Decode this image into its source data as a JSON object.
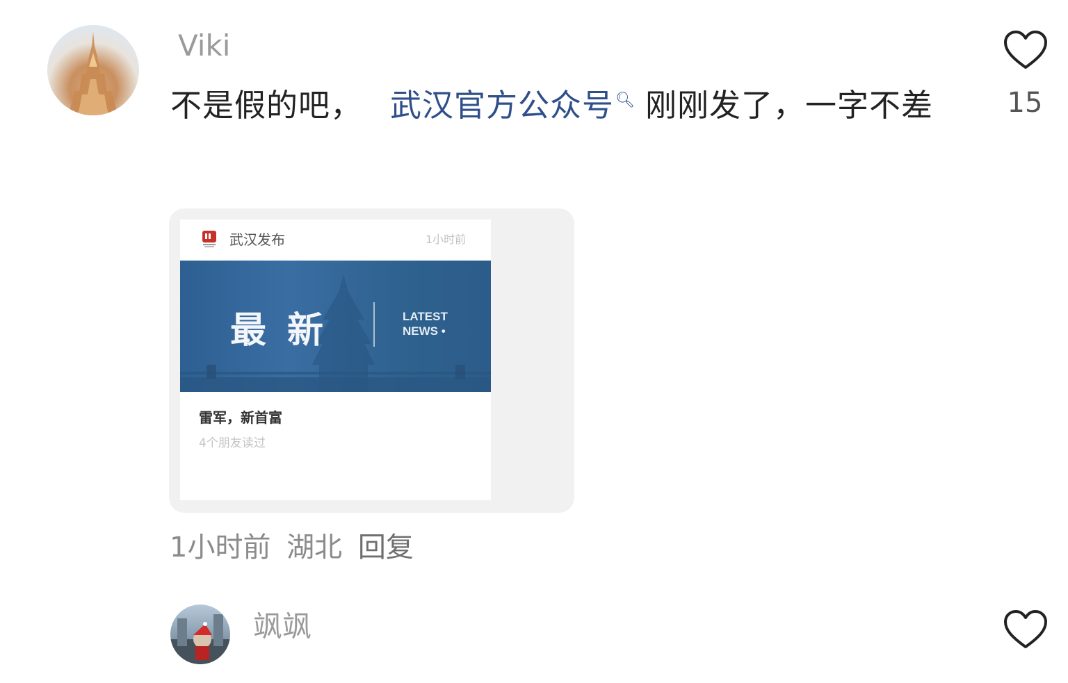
{
  "comment1": {
    "username": "Viki",
    "text_before": "不是假的吧，",
    "link_text": "武汉官方公众号",
    "link_icon": "search-icon",
    "text_after": "刚刚发了，一字不差",
    "like_icon": "heart-outline-icon",
    "like_count": "15",
    "card": {
      "source": "武汉发布",
      "time": "1小时前",
      "banner_cn": "最新",
      "banner_en_1": "LATEST",
      "banner_en_2": "NEWS •",
      "headline": "雷军，新首富",
      "readers": "4个朋友读过"
    },
    "meta_time": "1小时前",
    "meta_location": "湖北",
    "meta_reply": "回复"
  },
  "comment2": {
    "username": "飒飒",
    "like_icon": "heart-outline-icon"
  },
  "colors": {
    "link": "#2f4f8a",
    "banner_blue": "#2e5f92",
    "muted_text": "#8b8b8b"
  }
}
